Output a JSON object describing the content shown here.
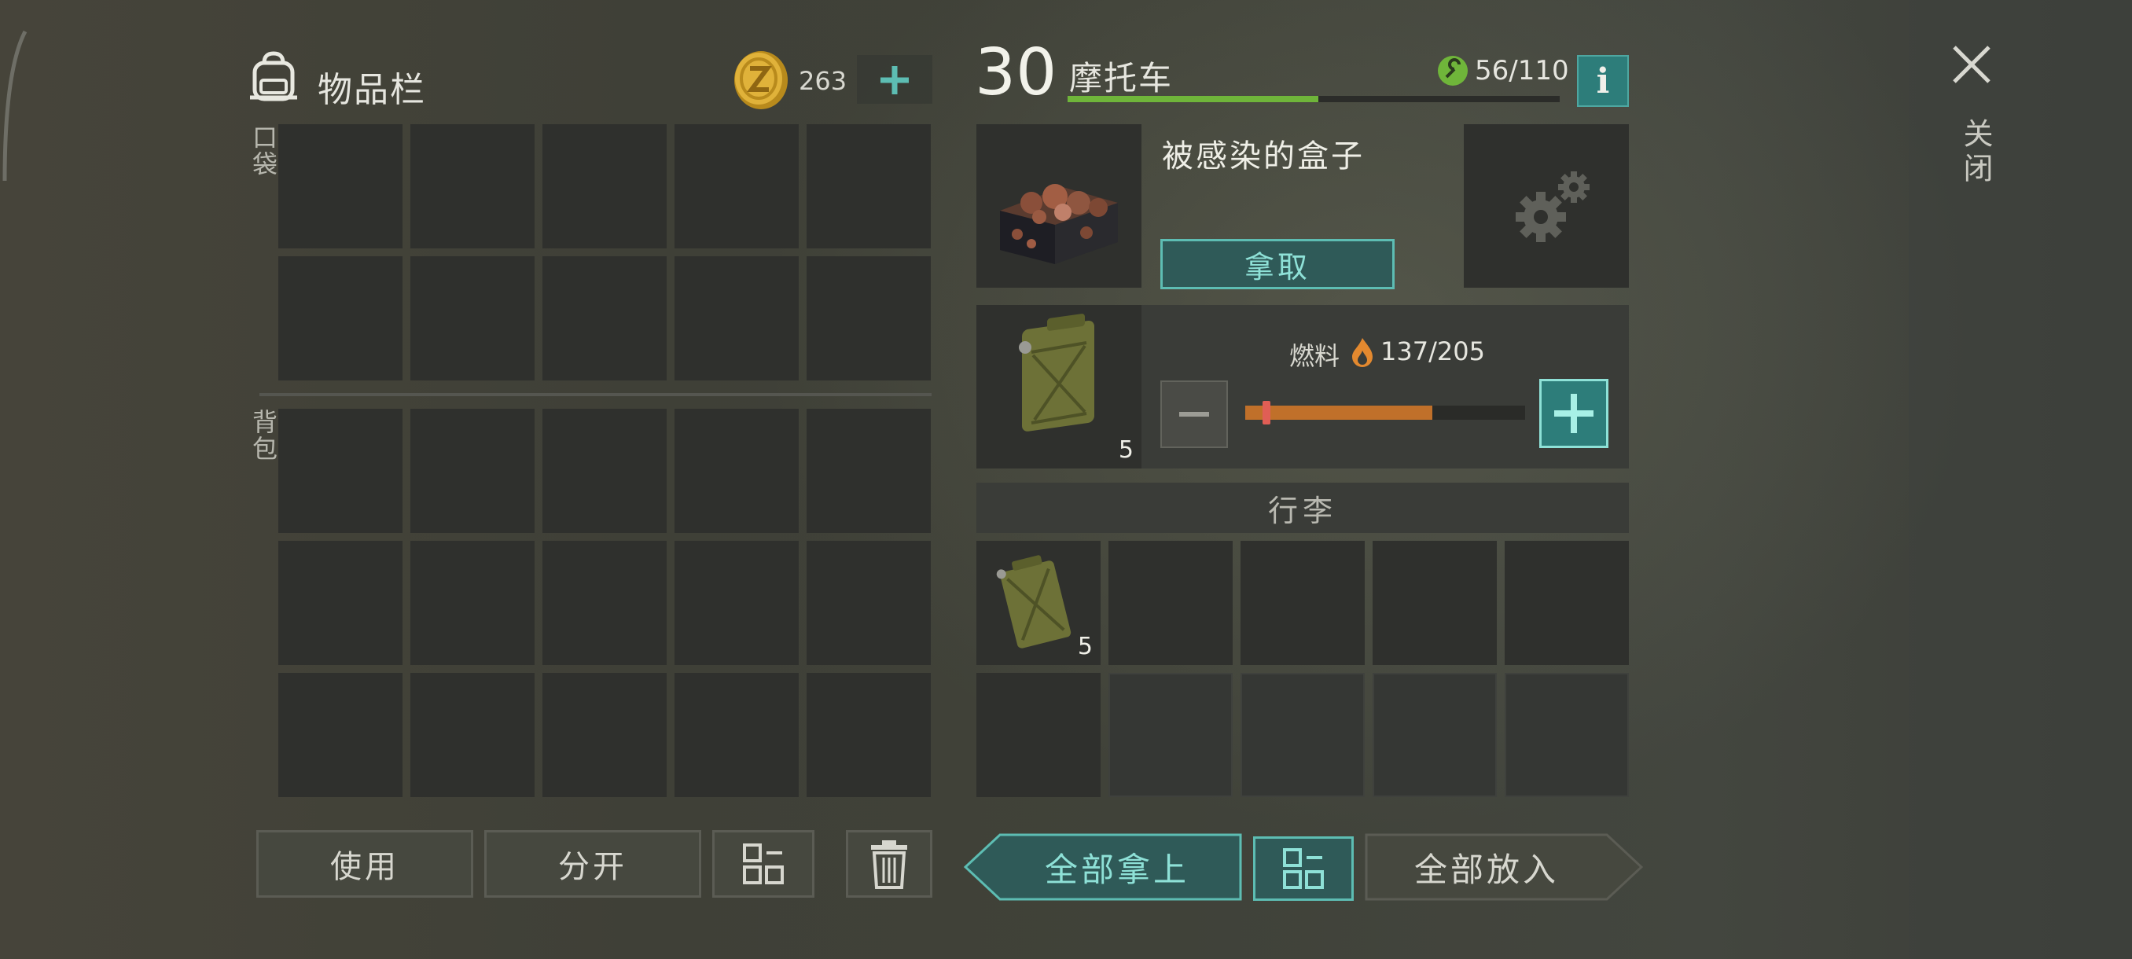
{
  "inventory": {
    "title": "物品栏",
    "coins": "263",
    "pocket_label": "口袋",
    "backpack_label": "背包",
    "buttons": {
      "use": "使用",
      "split": "分开"
    }
  },
  "vehicle": {
    "level": "30",
    "name": "摩托车",
    "durability": "56/110",
    "durability_fraction": 0.51,
    "info_label": "i"
  },
  "container": {
    "name": "被感染的盒子",
    "take_button": "拿取"
  },
  "fuel": {
    "label": "燃料",
    "value": "137/205",
    "fraction": 0.668,
    "item_count": "5"
  },
  "luggage": {
    "title": "行李",
    "items": [
      {
        "name": "jerry-can",
        "count": "5"
      }
    ]
  },
  "actions": {
    "take_all": "全部拿上",
    "put_all": "全部放入"
  },
  "close": {
    "label": "关闭"
  },
  "colors": {
    "accent_teal": "#5dbdb3",
    "fuel_orange": "#c0702a",
    "durability_green": "#6fb53a"
  }
}
